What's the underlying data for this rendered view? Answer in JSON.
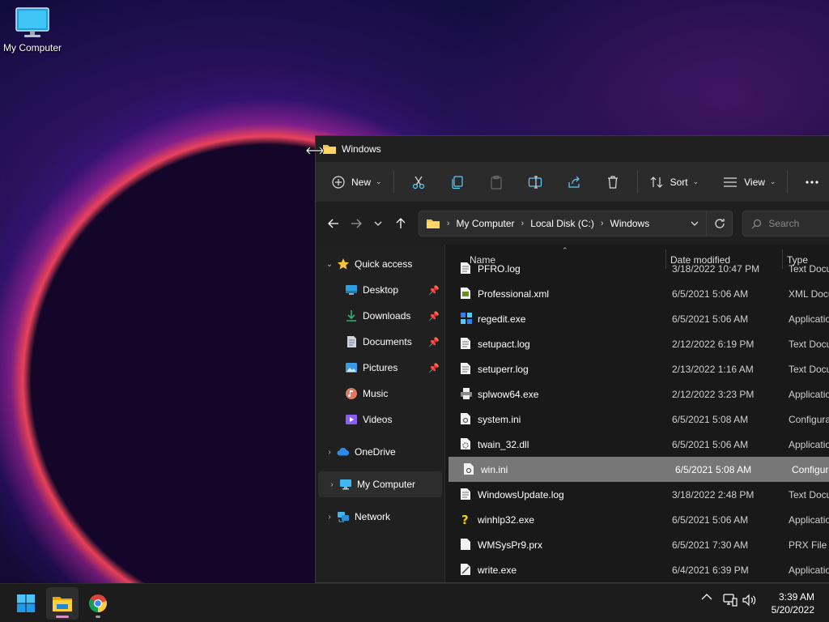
{
  "desktop": {
    "icons": [
      {
        "label": "My Computer",
        "icon": "monitor-icon"
      }
    ]
  },
  "window": {
    "title": "Windows",
    "toolbar": {
      "new_label": "New",
      "sort_label": "Sort",
      "view_label": "View",
      "icons": [
        "cut-icon",
        "copy-icon",
        "paste-icon",
        "rename-icon",
        "share-icon",
        "delete-icon"
      ]
    },
    "address": {
      "crumbs": [
        "My Computer",
        "Local Disk (C:)",
        "Windows"
      ]
    },
    "search": {
      "placeholder": "Search"
    },
    "nav": {
      "quick_access": "Quick access",
      "items": [
        {
          "label": "Desktop",
          "pinned": true
        },
        {
          "label": "Downloads",
          "pinned": true
        },
        {
          "label": "Documents",
          "pinned": true
        },
        {
          "label": "Pictures",
          "pinned": true
        },
        {
          "label": "Music",
          "pinned": false
        },
        {
          "label": "Videos",
          "pinned": false
        }
      ],
      "onedrive": "OneDrive",
      "my_computer": "My Computer",
      "network": "Network"
    },
    "columns": {
      "name": "Name",
      "date": "Date modified",
      "type": "Type"
    },
    "files": [
      {
        "name": "PFRO.log",
        "date": "3/18/2022 10:47 PM",
        "type": "Text Document"
      },
      {
        "name": "Professional.xml",
        "date": "6/5/2021 5:06 AM",
        "type": "XML Document"
      },
      {
        "name": "regedit.exe",
        "date": "6/5/2021 5:06 AM",
        "type": "Application"
      },
      {
        "name": "setupact.log",
        "date": "2/12/2022 6:19 PM",
        "type": "Text Document"
      },
      {
        "name": "setuperr.log",
        "date": "2/13/2022 1:16 AM",
        "type": "Text Document"
      },
      {
        "name": "splwow64.exe",
        "date": "2/12/2022 3:23 PM",
        "type": "Application"
      },
      {
        "name": "system.ini",
        "date": "6/5/2021 5:08 AM",
        "type": "Configuration settings"
      },
      {
        "name": "twain_32.dll",
        "date": "6/5/2021 5:06 AM",
        "type": "Application extension"
      },
      {
        "name": "win.ini",
        "date": "6/5/2021 5:08 AM",
        "type": "Configuration settings",
        "selected": true
      },
      {
        "name": "WindowsUpdate.log",
        "date": "3/18/2022 2:48 PM",
        "type": "Text Document"
      },
      {
        "name": "winhlp32.exe",
        "date": "6/5/2021 5:06 AM",
        "type": "Application"
      },
      {
        "name": "WMSysPr9.prx",
        "date": "6/5/2021 7:30 AM",
        "type": "PRX File"
      },
      {
        "name": "write.exe",
        "date": "6/4/2021 6:39 PM",
        "type": "Application"
      }
    ]
  },
  "taskbar": {
    "apps": [
      "start-icon",
      "file-explorer-icon",
      "chrome-icon"
    ],
    "time": "3:39 AM",
    "date": "5/20/2022"
  },
  "colors": {
    "accent": "#60cdff",
    "folder": "#f5c542",
    "selection": "#777777"
  }
}
